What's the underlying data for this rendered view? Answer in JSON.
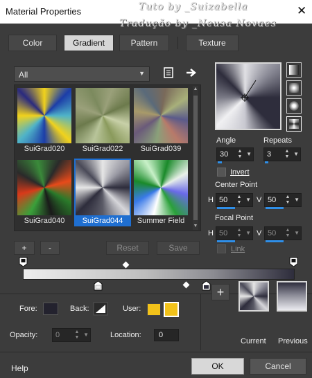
{
  "window": {
    "title": "Material Properties",
    "watermark_line1": "Tuto by _Suizabella",
    "watermark_line2": "Tradução by _Neusa Novaes",
    "close_glyph": "✕"
  },
  "tabs": [
    {
      "label": "Color",
      "active": false
    },
    {
      "label": "Gradient",
      "active": true
    },
    {
      "label": "Pattern",
      "active": false
    },
    {
      "label": "Texture",
      "active": false
    }
  ],
  "category_select": {
    "value": "All"
  },
  "gradients": [
    {
      "label": "SuiGrad020",
      "selected": false
    },
    {
      "label": "SuiGrad022",
      "selected": false
    },
    {
      "label": "SuiGrad039",
      "selected": false
    },
    {
      "label": "SuiGrad040",
      "selected": false
    },
    {
      "label": "SuiGrad044",
      "selected": true
    },
    {
      "label": "Summer Field",
      "selected": false
    }
  ],
  "list_buttons": {
    "add": "+",
    "remove": "-",
    "reset": "Reset",
    "save": "Save"
  },
  "settings": {
    "angle_label": "Angle",
    "angle": "30",
    "repeats_label": "Repeats",
    "repeats": "3",
    "invert_label": "Invert",
    "invert_checked": false,
    "center_point_label": "Center Point",
    "center_h_label": "H",
    "center_h": "50",
    "center_v_label": "V",
    "center_v": "50",
    "focal_point_label": "Focal Point",
    "focal_h_label": "H",
    "focal_h": "50",
    "focal_v_label": "V",
    "focal_v": "50",
    "link_label": "Link",
    "link_checked": false
  },
  "stop_editor": {
    "fore_label": "Fore:",
    "back_label": "Back:",
    "user_label": "User:",
    "opacity_label": "Opacity:",
    "opacity": "0",
    "location_label": "Location:",
    "location": "0",
    "user_color": "#f2c21a",
    "fore_color": "#23222e"
  },
  "preview": {
    "add_label": "+",
    "current_label": "Current",
    "previous_label": "Previous"
  },
  "footer": {
    "help": "Help",
    "ok": "OK",
    "cancel": "Cancel"
  },
  "colors": {
    "accent": "#1f6fd1",
    "bar_blue": "#2f8fe8"
  }
}
